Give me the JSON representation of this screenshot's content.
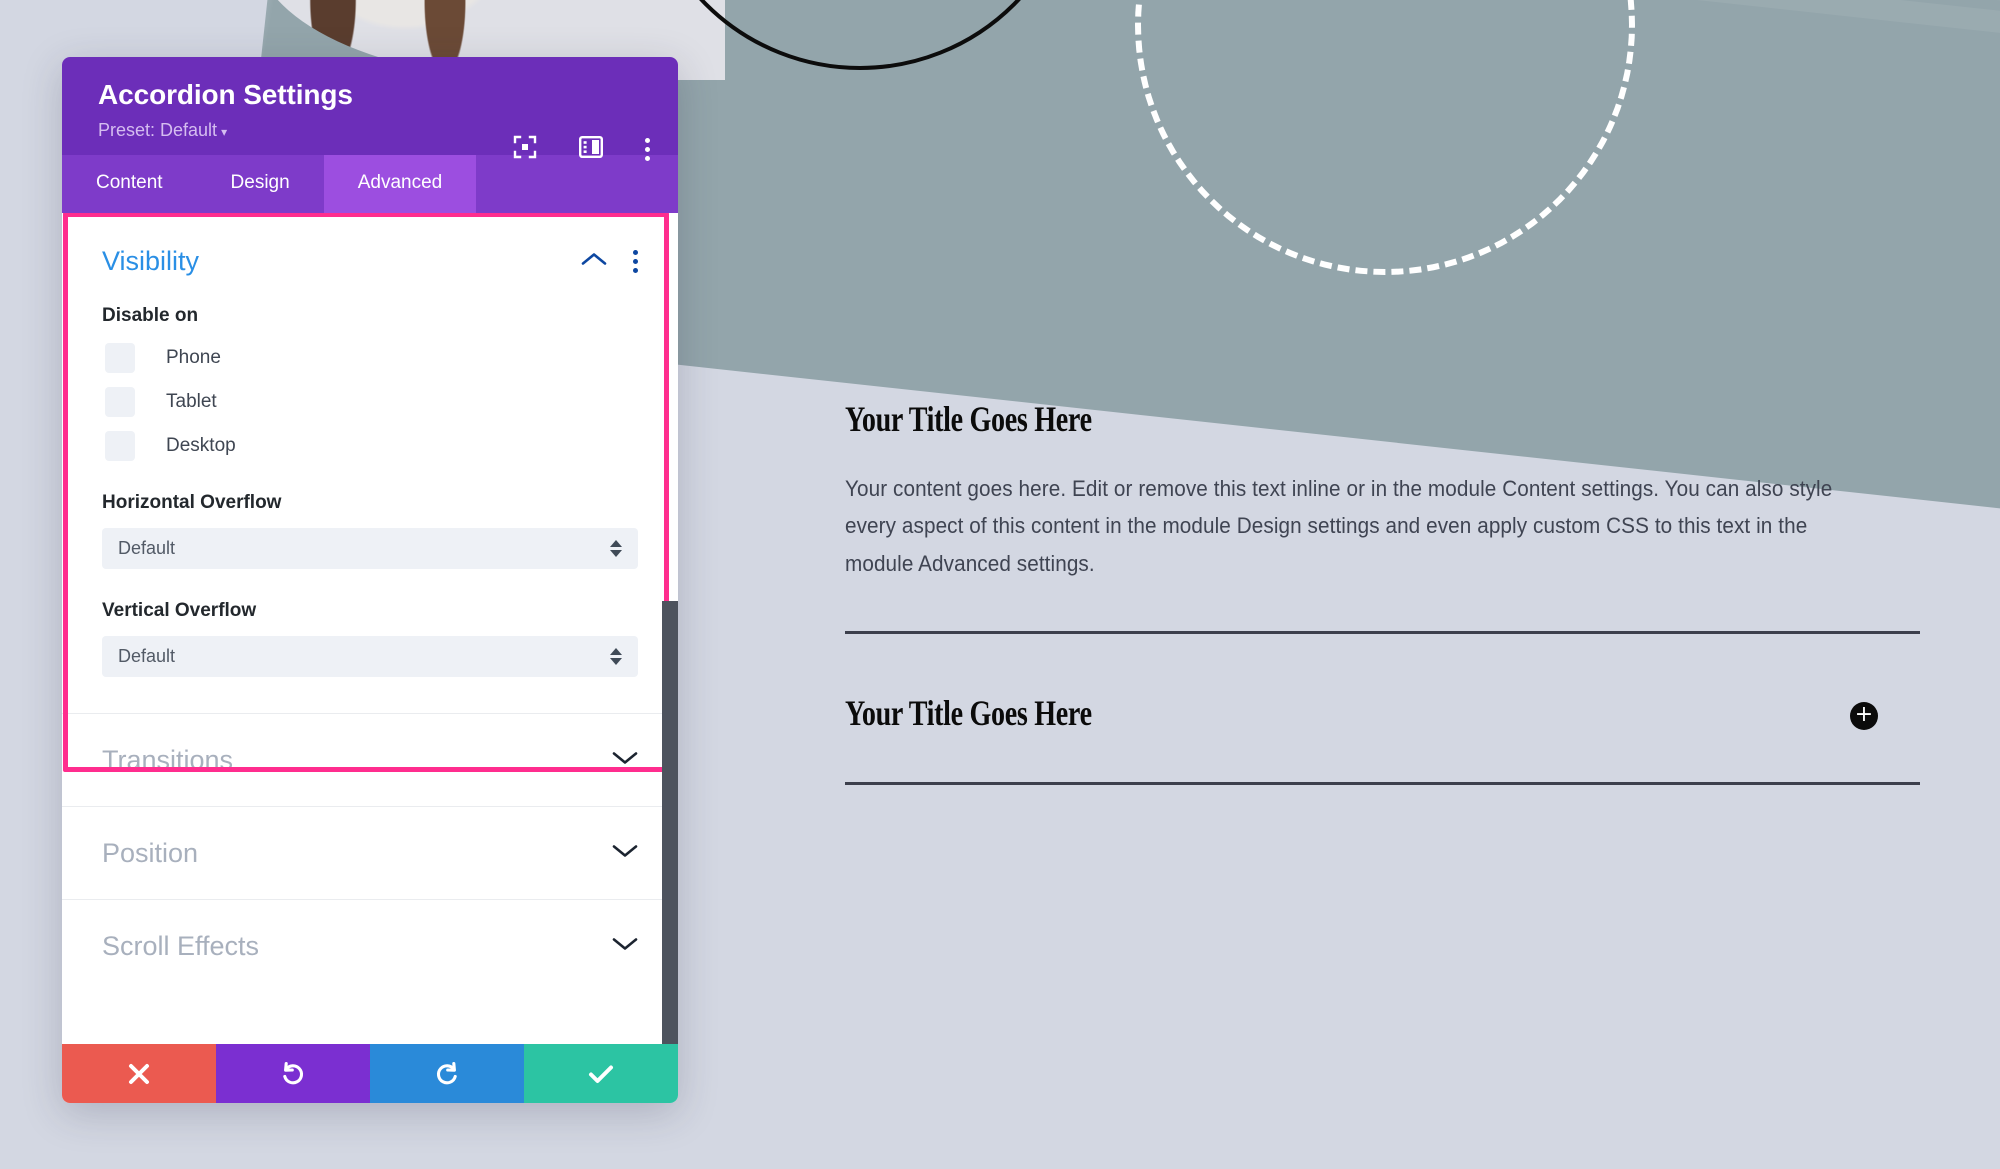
{
  "modal": {
    "title": "Accordion Settings",
    "preset_label": "Preset: Default",
    "preset_caret": "▾",
    "header_icons": [
      {
        "name": "focus-target-icon"
      },
      {
        "name": "layout-panel-icon"
      },
      {
        "name": "more-options-icon"
      }
    ],
    "tabs": [
      {
        "label": "Content",
        "active": false
      },
      {
        "label": "Design",
        "active": false
      },
      {
        "label": "Advanced",
        "active": true
      }
    ],
    "visibility_section": {
      "title": "Visibility",
      "expanded": true,
      "disable_on_label": "Disable on",
      "checkboxes": [
        {
          "label": "Phone",
          "checked": false
        },
        {
          "label": "Tablet",
          "checked": false
        },
        {
          "label": "Desktop",
          "checked": false
        }
      ],
      "horizontal_overflow": {
        "label": "Horizontal Overflow",
        "value": "Default"
      },
      "vertical_overflow": {
        "label": "Vertical Overflow",
        "value": "Default"
      }
    },
    "collapsed_sections": [
      {
        "label": "Transitions"
      },
      {
        "label": "Position"
      },
      {
        "label": "Scroll Effects"
      }
    ],
    "footer_buttons": [
      {
        "name": "cancel-button",
        "glyph": "✖"
      },
      {
        "name": "undo-button",
        "glyph": "↺"
      },
      {
        "name": "redo-button",
        "glyph": "↻"
      },
      {
        "name": "save-button",
        "glyph": "✔"
      }
    ],
    "colors": {
      "header_purple": "#6c2eb9",
      "tabbar_purple": "#7e3bc9",
      "active_tab_purple": "#9c4ee0",
      "highlight_pink": "#ff2d8e",
      "section_open_blue": "#2a8fe5",
      "section_closed_gray": "#a8b0bd",
      "field_bg": "#eef1f6",
      "cancel_red": "#eb5a50",
      "undo_purple": "#7b2fd1",
      "redo_blue": "#2a8ad9",
      "save_teal": "#2cc4a3",
      "scrollbar_gray": "#4d535e"
    }
  },
  "content": {
    "item1": {
      "title": "Your Title Goes Here",
      "body": "Your content goes here. Edit or remove this text inline or in the module Content settings. You can also style every aspect of this content in the module Design settings and even apply custom CSS to this text in the module Advanced settings."
    },
    "item2": {
      "title": "Your Title Goes Here",
      "toggle_glyph": "+"
    },
    "colors": {
      "page_bg": "#d3d7e2",
      "band_teal_gray": "#93a5ab",
      "rule": "#3c3f4c",
      "title_black": "#0b0b0b",
      "body_gray": "#3f4452"
    }
  }
}
